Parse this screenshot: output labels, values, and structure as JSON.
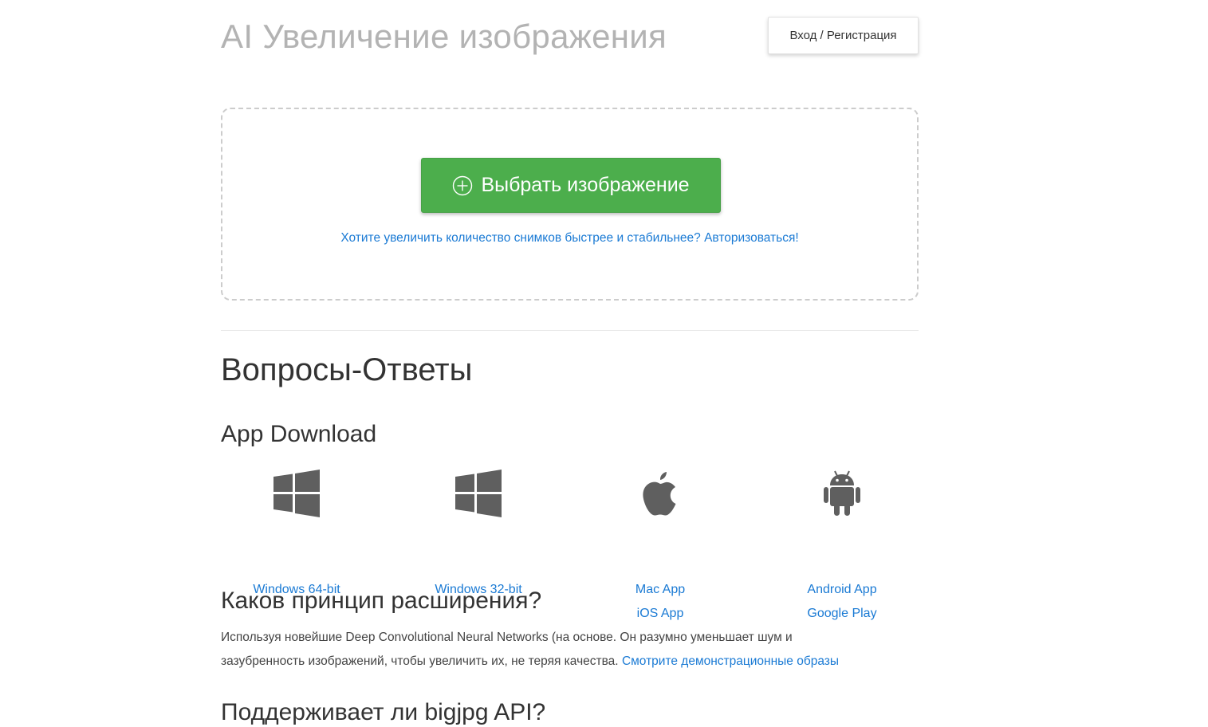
{
  "header": {
    "title": "AI Увеличение изображения",
    "login_label": "Вход / Регистрация"
  },
  "upload": {
    "button_icon": "plus-circle-icon",
    "button_label": "Выбрать изображение",
    "auth_hint": "Хотите увеличить количество снимков быстрее и стабильнее? Авторизоваться!"
  },
  "faq": {
    "title": "Вопросы-Ответы",
    "app_download": {
      "title": "App Download",
      "apps": [
        {
          "icon": "windows-icon",
          "links": [
            "Windows 64-bit"
          ]
        },
        {
          "icon": "windows-icon",
          "links": [
            "Windows 32-bit"
          ]
        },
        {
          "icon": "apple-icon",
          "links": [
            "Mac App",
            "iOS App"
          ]
        },
        {
          "icon": "android-icon",
          "links": [
            "Android App",
            "Google Play"
          ]
        }
      ]
    },
    "question1": {
      "title": "Каков принцип расширения?",
      "text_line1": "Используя новейшие Deep Convolutional Neural Networks (на основе. Он разумно уменьшает шум и",
      "text_line2": "зазубренность изображений, чтобы увеличить их, не теряя качества.",
      "link": "Смотрите демонстрационные образы"
    },
    "question2": {
      "title": "Поддерживает ли bigjpg API?"
    }
  },
  "colors": {
    "accent_green": "#4cae4c",
    "link_blue": "#1a7ad4",
    "title_gray": "#b3b3b3",
    "icon_gray": "#5f5f5f"
  }
}
